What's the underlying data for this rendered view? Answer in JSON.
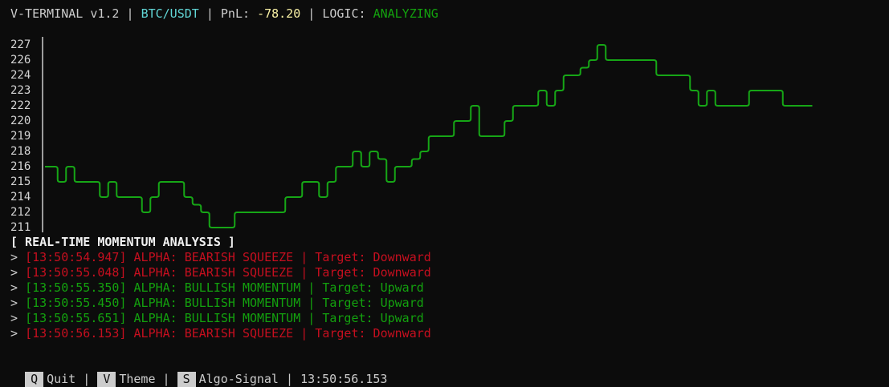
{
  "header": {
    "app": "V-TERMINAL v1.2",
    "pair": "BTC/USDT",
    "pnl_label": "PnL:",
    "pnl_value": "-78.20",
    "logic_label": "LOGIC:",
    "logic_value": "ANALYZING",
    "separator": " | "
  },
  "colors": {
    "background": "#0c0c0c",
    "text": "#cccccc",
    "pair": "#61d6d6",
    "pnl": "#f9f1a5",
    "bullish": "#13a10e",
    "bearish": "#c50f1f",
    "line": "#16a616"
  },
  "chart_data": {
    "type": "line",
    "y_ticks": [
      "227",
      "226",
      "224",
      "223",
      "222",
      "220",
      "219",
      "218",
      "216",
      "215",
      "214",
      "212",
      "211"
    ],
    "ylim": [
      211,
      227
    ],
    "series": [
      {
        "values": [
          216,
          216,
          215,
          216,
          215,
          215,
          215,
          214,
          215,
          214,
          214,
          214,
          212,
          214,
          215,
          215,
          215,
          214,
          213,
          212,
          211,
          211,
          211,
          212,
          212,
          212,
          212,
          212,
          212,
          214,
          214,
          215,
          215,
          214,
          215,
          216,
          216,
          218,
          216,
          218,
          217,
          215,
          216,
          216,
          217,
          218,
          219,
          219,
          219,
          220,
          220,
          222,
          219,
          219,
          219,
          220,
          222,
          222,
          222,
          223,
          222,
          223,
          224,
          224,
          225,
          226,
          227,
          226,
          226,
          226,
          226,
          226,
          226,
          224,
          224,
          224,
          224,
          223,
          222,
          223,
          222,
          222,
          222,
          222,
          223,
          223,
          223,
          223,
          222,
          222,
          222,
          222
        ]
      }
    ]
  },
  "analysis": {
    "title": "[ REAL-TIME MOMENTUM ANALYSIS ]",
    "prompt": "> ",
    "logs": [
      {
        "text": "[13:50:54.947] ALPHA: BEARISH SQUEEZE | Target: Downward",
        "kind": "bear"
      },
      {
        "text": "[13:50:55.048] ALPHA: BEARISH SQUEEZE | Target: Downward",
        "kind": "bear"
      },
      {
        "text": "[13:50:55.350] ALPHA: BULLISH MOMENTUM | Target: Upward",
        "kind": "bull"
      },
      {
        "text": "[13:50:55.450] ALPHA: BULLISH MOMENTUM | Target: Upward",
        "kind": "bull"
      },
      {
        "text": "[13:50:55.651] ALPHA: BULLISH MOMENTUM | Target: Upward",
        "kind": "bull"
      },
      {
        "text": "[13:50:56.153] ALPHA: BEARISH SQUEEZE | Target: Downward",
        "kind": "bear"
      }
    ]
  },
  "footer": {
    "keys": [
      {
        "key": "Q",
        "label": "Quit"
      },
      {
        "key": "V",
        "label": "Theme"
      },
      {
        "key": "S",
        "label": "Algo-Signal"
      }
    ],
    "separator": " | ",
    "time": "13:50:56.153"
  }
}
